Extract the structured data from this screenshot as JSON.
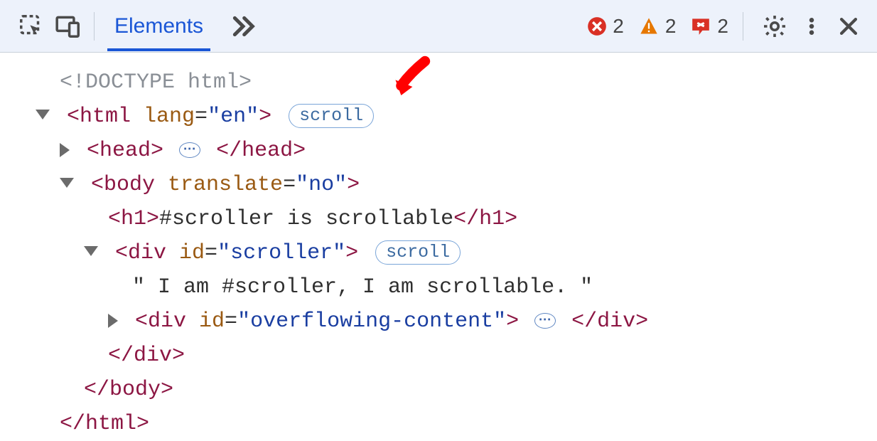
{
  "toolbar": {
    "tab_label": "Elements",
    "more_tabs": "»",
    "errors": 2,
    "warnings": 2,
    "issues": 2
  },
  "dom": {
    "doctype": "<!DOCTYPE html>",
    "html_open_1": "<html",
    "html_lang_attr": " lang",
    "html_eq": "=",
    "html_lang_val": "\"en\"",
    "html_open_close": ">",
    "scroll_badge": "scroll",
    "head_open": "<head>",
    "head_close": "</head>",
    "body_open_1": "<body",
    "body_attr": " translate",
    "body_val": "\"no\"",
    "body_close_br": ">",
    "h1_open": "<h1>",
    "h1_text": "#scroller is scrollable",
    "h1_close": "</h1>",
    "div1_open_1": "<div",
    "div1_attr": " id",
    "div1_val": "\"scroller\"",
    "div1_close_br": ">",
    "scroll_badge2": "scroll",
    "scroller_text": "\" I am #scroller, I am scrollable. \"",
    "div2_open_1": "<div",
    "div2_attr": " id",
    "div2_val": "\"overflowing-content\"",
    "div2_close_br": ">",
    "div_close": "</div>",
    "body_close": "</body>",
    "html_close": "</html>",
    "ellipsis": "⋯"
  }
}
